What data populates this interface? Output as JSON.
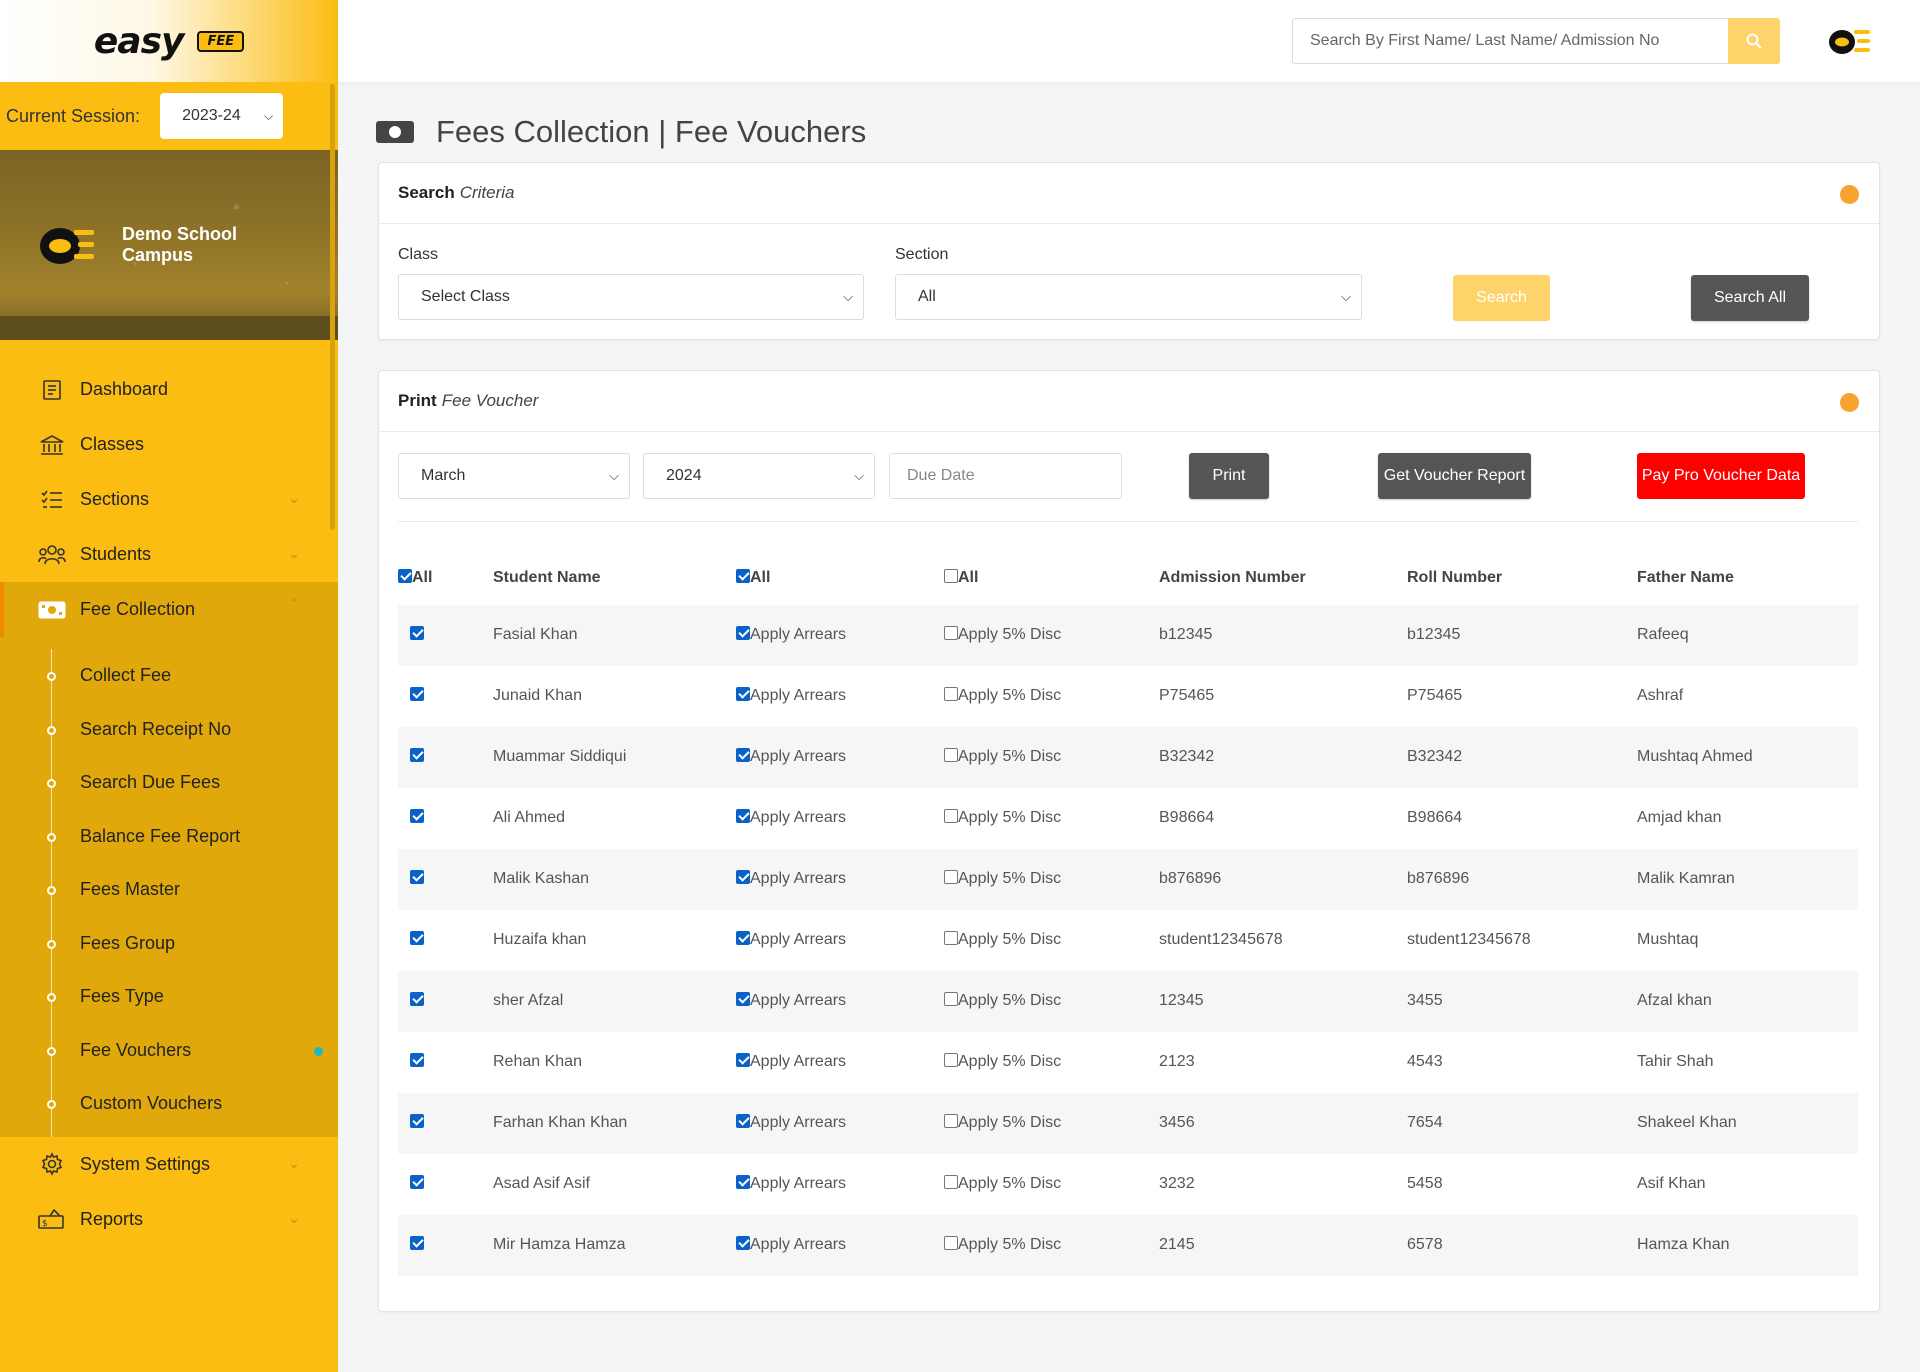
{
  "brand": {
    "logo_text": "easy",
    "logo_badge": "FEE"
  },
  "session": {
    "label": "Current Session:",
    "value": "2023-24"
  },
  "campus": {
    "name": "Demo School Campus"
  },
  "nav": {
    "items": [
      {
        "label": "Dashboard",
        "icon": "dashboard-icon"
      },
      {
        "label": "Classes",
        "icon": "bank-icon"
      },
      {
        "label": "Sections",
        "icon": "list-icon"
      },
      {
        "label": "Students",
        "icon": "students-icon"
      },
      {
        "label": "Fee Collection",
        "icon": "money-icon"
      }
    ],
    "sub_items": [
      "Collect Fee",
      "Search Receipt No",
      "Search Due Fees",
      "Balance Fee Report",
      "Fees Master",
      "Fees Group",
      "Fees Type",
      "Fee Vouchers",
      "Custom Vouchers"
    ],
    "bottom_items": [
      {
        "label": "System Settings",
        "icon": "gear-icon"
      },
      {
        "label": "Reports",
        "icon": "reports-icon"
      }
    ]
  },
  "topbar": {
    "search_placeholder": "Search By First Name/ Last Name/ Admission No"
  },
  "page": {
    "title": "Fees Collection | Fee Vouchers"
  },
  "search_card": {
    "title_bold": "Search",
    "title_italic": "Criteria",
    "class_label": "Class",
    "class_value": "Select Class",
    "section_label": "Section",
    "section_value": "All",
    "search_btn": "Search",
    "search_all_btn": "Search All"
  },
  "print_card": {
    "title_bold": "Print",
    "title_italic": "Fee Voucher",
    "month_value": "March",
    "year_value": "2024",
    "due_date_placeholder": "Due Date",
    "print_btn": "Print",
    "report_btn": "Get Voucher Report",
    "paypro_btn": "Pay Pro Voucher Data"
  },
  "table": {
    "headers": {
      "all1": "All",
      "student_name": "Student Name",
      "all2": "All",
      "all3": "All",
      "admission": "Admission Number",
      "roll": "Roll Number",
      "father": "Father Name"
    },
    "header_checks": [
      true,
      true,
      false
    ],
    "arrears_label": "Apply Arrears",
    "disc_label": "Apply 5% Disc",
    "rows": [
      {
        "name": "Fasial Khan",
        "admission": "b12345",
        "roll": "b12345",
        "father": "Rafeeq"
      },
      {
        "name": "Junaid Khan",
        "admission": "P75465",
        "roll": "P75465",
        "father": "Ashraf"
      },
      {
        "name": "Muammar Siddiqui",
        "admission": "B32342",
        "roll": "B32342",
        "father": "Mushtaq Ahmed"
      },
      {
        "name": "Ali Ahmed",
        "admission": "B98664",
        "roll": "B98664",
        "father": "Amjad khan"
      },
      {
        "name": "Malik Kashan",
        "admission": "b876896",
        "roll": "b876896",
        "father": "Malik Kamran"
      },
      {
        "name": "Huzaifa khan",
        "admission": "student12345678",
        "roll": "student12345678",
        "father": "Mushtaq"
      },
      {
        "name": "sher Afzal",
        "admission": "12345",
        "roll": "3455",
        "father": "Afzal khan"
      },
      {
        "name": "Rehan Khan",
        "admission": "2123",
        "roll": "4543",
        "father": "Tahir Shah"
      },
      {
        "name": "Farhan Khan Khan",
        "admission": "3456",
        "roll": "7654",
        "father": "Shakeel Khan"
      },
      {
        "name": "Asad Asif Asif",
        "admission": "3232",
        "roll": "5458",
        "father": "Asif Khan"
      },
      {
        "name": "Mir Hamza Hamza",
        "admission": "2145",
        "roll": "6578",
        "father": "Hamza Khan"
      }
    ]
  },
  "colors": {
    "sidebar": "#fbbd12",
    "accent_orange": "#f7a42e",
    "danger": "#ff0000",
    "dark_button": "#555555"
  }
}
